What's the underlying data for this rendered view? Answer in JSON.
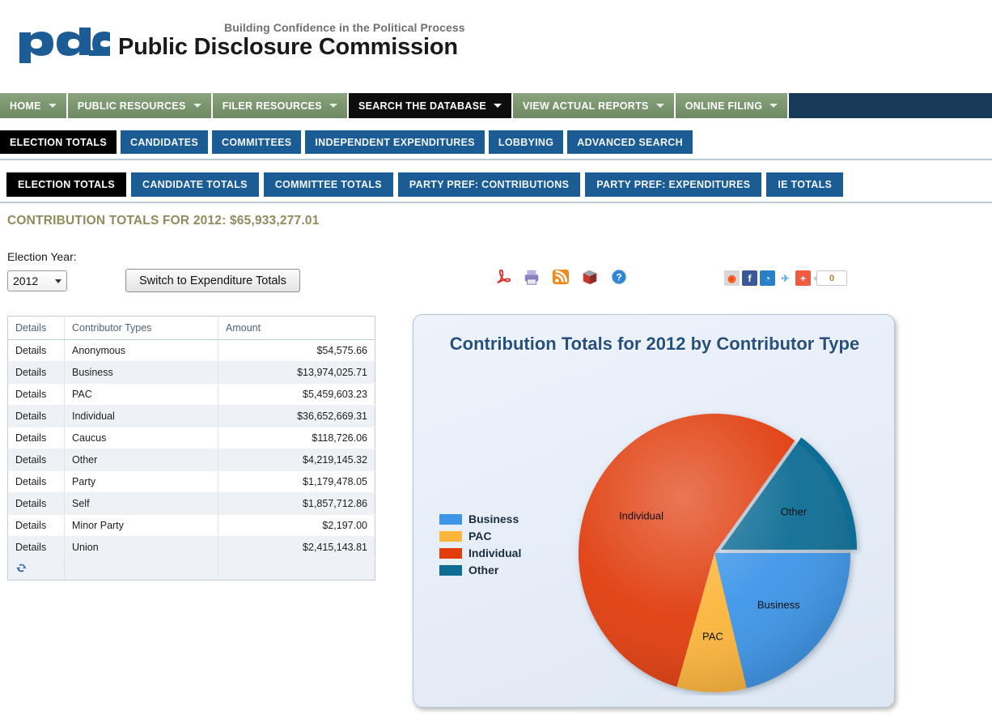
{
  "header": {
    "logo_text": "pdc",
    "tagline": "Building Confidence in the Political Process",
    "org_title": "Public Disclosure Commission"
  },
  "primary_nav": [
    {
      "label": "HOME",
      "active": false,
      "has_caret": true
    },
    {
      "label": "PUBLIC RESOURCES",
      "active": false,
      "has_caret": true
    },
    {
      "label": "FILER RESOURCES",
      "active": false,
      "has_caret": true
    },
    {
      "label": "SEARCH THE DATABASE",
      "active": true,
      "has_caret": true
    },
    {
      "label": "VIEW ACTUAL REPORTS",
      "active": false,
      "has_caret": true
    },
    {
      "label": "ONLINE FILING",
      "active": false,
      "has_caret": true
    }
  ],
  "secondary_nav": [
    {
      "label": "ELECTION TOTALS",
      "active": true
    },
    {
      "label": "CANDIDATES",
      "active": false
    },
    {
      "label": "COMMITTEES",
      "active": false
    },
    {
      "label": "INDEPENDENT EXPENDITURES",
      "active": false
    },
    {
      "label": "LOBBYING",
      "active": false
    },
    {
      "label": "ADVANCED SEARCH",
      "active": false
    }
  ],
  "tertiary_tabs": [
    {
      "label": "ELECTION TOTALS",
      "active": true
    },
    {
      "label": "CANDIDATE TOTALS",
      "active": false
    },
    {
      "label": "COMMITTEE TOTALS",
      "active": false
    },
    {
      "label": "PARTY PREF: CONTRIBUTIONS",
      "active": false
    },
    {
      "label": "PARTY PREF: EXPENDITURES",
      "active": false
    },
    {
      "label": "IE TOTALS",
      "active": false
    }
  ],
  "page_heading": "CONTRIBUTION TOTALS FOR 2012: $65,933,277.01",
  "controls": {
    "year_label": "Election Year:",
    "year_value": "2012",
    "year_options": [
      "2012"
    ],
    "switch_button": "Switch to Expenditure Totals"
  },
  "export_icons": [
    {
      "name": "pdf-export-icon"
    },
    {
      "name": "print-export-icon"
    },
    {
      "name": "rss-feed-icon"
    },
    {
      "name": "data-export-icon"
    },
    {
      "name": "help-icon"
    }
  ],
  "share_bar": {
    "icons": [
      {
        "name": "reddit-share-icon",
        "glyph": "◉",
        "color": "#d8d8d8",
        "fg": "#ff4500"
      },
      {
        "name": "facebook-share-icon",
        "glyph": "f",
        "color": "#3b5998",
        "fg": "#ffffff"
      },
      {
        "name": "email-share-icon",
        "glyph": "◔",
        "color": "#2a7fc9",
        "fg": "#ffffff"
      },
      {
        "name": "twitter-share-icon",
        "glyph": "✈",
        "color": "#ffffff",
        "fg": "#55acee"
      },
      {
        "name": "addthis-share-icon",
        "glyph": "+",
        "color": "#f05b40",
        "fg": "#ffffff"
      }
    ],
    "count": "0"
  },
  "table": {
    "columns": [
      "Details",
      "Contributor Types",
      "Amount"
    ],
    "rows": [
      {
        "details": "Details",
        "type": "Anonymous",
        "amount": "$54,575.66"
      },
      {
        "details": "Details",
        "type": "Business",
        "amount": "$13,974,025.71"
      },
      {
        "details": "Details",
        "type": "PAC",
        "amount": "$5,459,603.23"
      },
      {
        "details": "Details",
        "type": "Individual",
        "amount": "$36,652,669.31"
      },
      {
        "details": "Details",
        "type": "Caucus",
        "amount": "$118,726.06"
      },
      {
        "details": "Details",
        "type": "Other",
        "amount": "$4,219,145.32"
      },
      {
        "details": "Details",
        "type": "Party",
        "amount": "$1,179,478.05"
      },
      {
        "details": "Details",
        "type": "Self",
        "amount": "$1,857,712.86"
      },
      {
        "details": "Details",
        "type": "Minor Party",
        "amount": "$2,197.00"
      },
      {
        "details": "Details",
        "type": "Union",
        "amount": "$2,415,143.81"
      }
    ],
    "footer_icon": "refresh-icon"
  },
  "chart_data": {
    "type": "pie",
    "title": "Contribution Totals for 2012 by Contributor Type",
    "categories": [
      "Business",
      "PAC",
      "Individual",
      "Other"
    ],
    "values": [
      13974025.71,
      5459603.23,
      36652669.31,
      9846978.76
    ],
    "percent": [
      21.2,
      8.3,
      55.6,
      14.9
    ],
    "colors": [
      "#3d95e8",
      "#fcb53b",
      "#e03c0c",
      "#0e6d94"
    ],
    "legend": [
      "Business",
      "PAC",
      "Individual",
      "Other"
    ],
    "legend_position": "left",
    "slice_labels": [
      "Business",
      "PAC",
      "Individual",
      "Other"
    ],
    "exploded_slice": "Other",
    "grid": false
  }
}
